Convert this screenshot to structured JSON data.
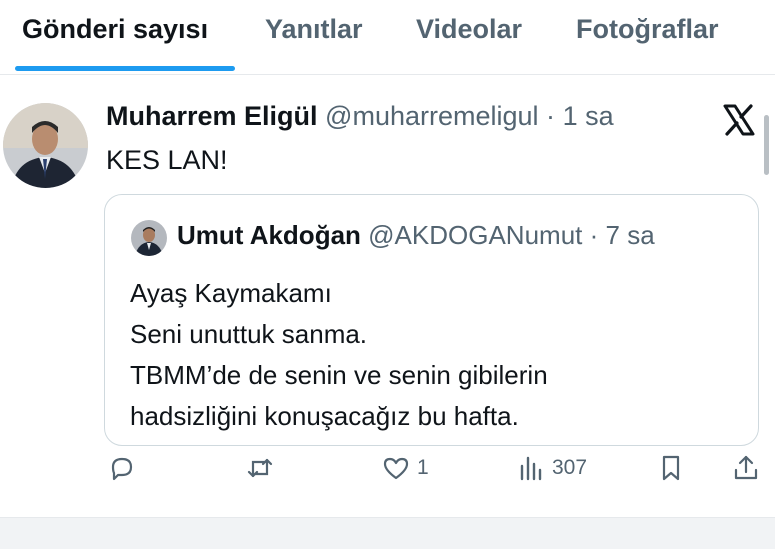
{
  "tabs": [
    {
      "label": "Gönderi sayısı",
      "active": true
    },
    {
      "label": "Yanıtlar",
      "active": false
    },
    {
      "label": "Videolar",
      "active": false
    },
    {
      "label": "Fotoğraflar",
      "active": false
    }
  ],
  "tweet": {
    "display_name": "Muharrem Eligül",
    "handle": "@muharremeligul",
    "separator": "·",
    "time": "1 sa",
    "text": "KES LAN!",
    "logo_icon": "x-logo-icon"
  },
  "quote": {
    "display_name": "Umut Akdoğan",
    "handle": "@AKDOGANumut",
    "separator": "·",
    "time": "7 sa",
    "lines": [
      "Ayaş Kaymakamı",
      "Seni unuttuk sanma.",
      "TBMM’de de senin ve senin gibilerin",
      "hadsizliğini konuşacağız bu hafta."
    ]
  },
  "actions": {
    "reply_count": "",
    "retweet_count": "",
    "like_count": "1",
    "views_count": "307"
  },
  "colors": {
    "accent": "#1d9bf0",
    "text_primary": "#0f1419",
    "text_secondary": "#536471",
    "border": "#cfd9de"
  }
}
